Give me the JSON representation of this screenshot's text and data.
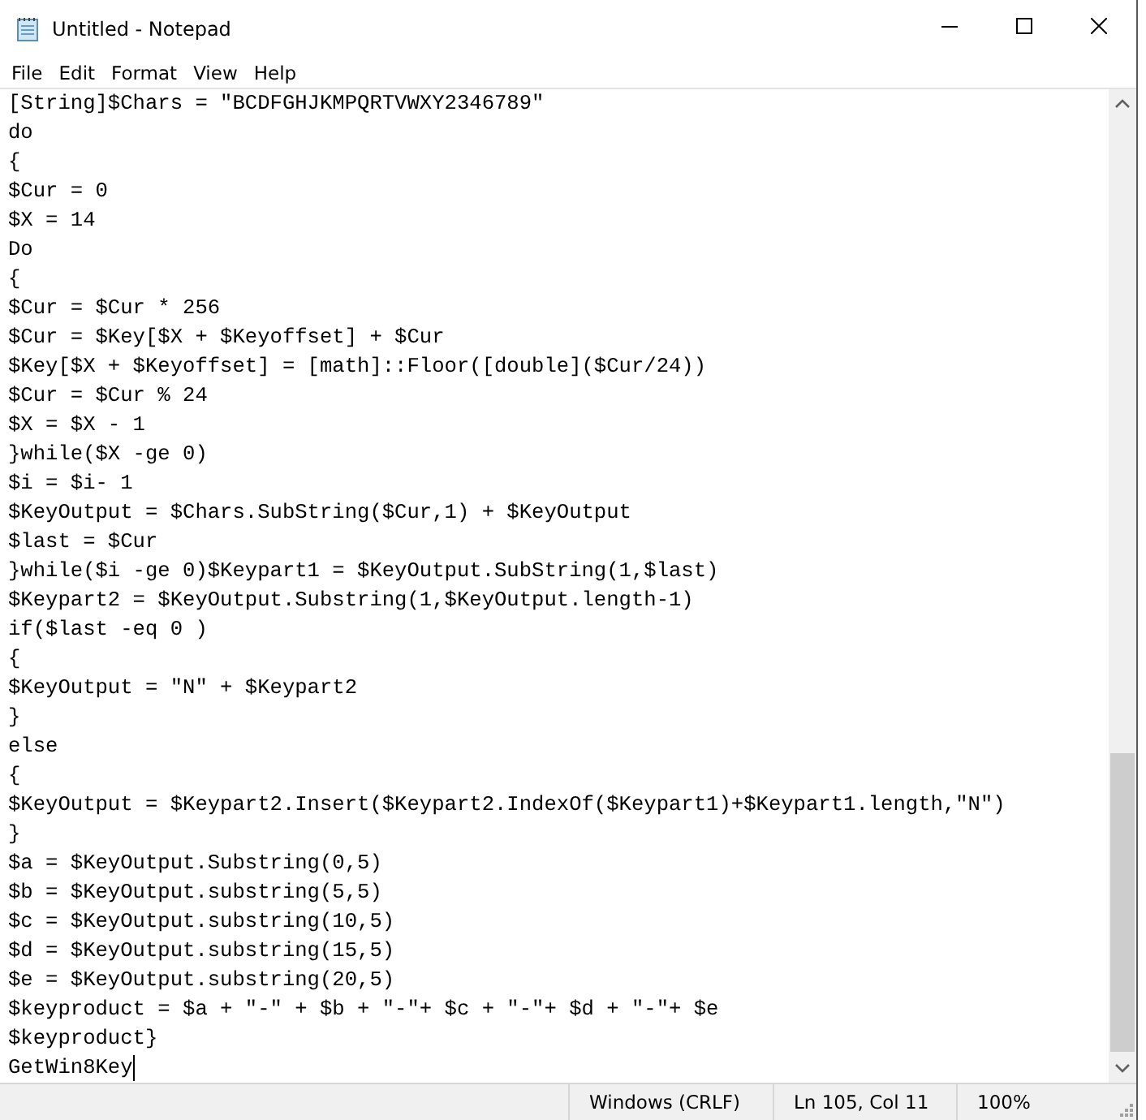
{
  "window": {
    "title": "Untitled - Notepad"
  },
  "menu": [
    "File",
    "Edit",
    "Format",
    "View",
    "Help"
  ],
  "editor": {
    "lines": [
      "[String]$Chars = \"BCDFGHJKMPQRTVWXY2346789\"",
      "do",
      "{",
      "$Cur = 0",
      "$X = 14",
      "Do",
      "{",
      "$Cur = $Cur * 256",
      "$Cur = $Key[$X + $Keyoffset] + $Cur",
      "$Key[$X + $Keyoffset] = [math]::Floor([double]($Cur/24))",
      "$Cur = $Cur % 24",
      "$X = $X - 1",
      "}while($X -ge 0)",
      "$i = $i- 1",
      "$KeyOutput = $Chars.SubString($Cur,1) + $KeyOutput",
      "$last = $Cur",
      "}while($i -ge 0)$Keypart1 = $KeyOutput.SubString(1,$last)",
      "$Keypart2 = $KeyOutput.Substring(1,$KeyOutput.length-1)",
      "if($last -eq 0 )",
      "{",
      "$KeyOutput = \"N\" + $Keypart2",
      "}",
      "else",
      "{",
      "$KeyOutput = $Keypart2.Insert($Keypart2.IndexOf($Keypart1)+$Keypart1.length,\"N\")",
      "}",
      "$a = $KeyOutput.Substring(0,5)",
      "$b = $KeyOutput.substring(5,5)",
      "$c = $KeyOutput.substring(10,5)",
      "$d = $KeyOutput.substring(15,5)",
      "$e = $KeyOutput.substring(20,5)",
      "$keyproduct = $a + \"-\" + $b + \"-\"+ $c + \"-\"+ $d + \"-\"+ $e",
      "$keyproduct}",
      "GetWin8Key"
    ]
  },
  "status_bar": [
    "Windows (CRLF)",
    "Ln 105, Col 11",
    "100%"
  ]
}
